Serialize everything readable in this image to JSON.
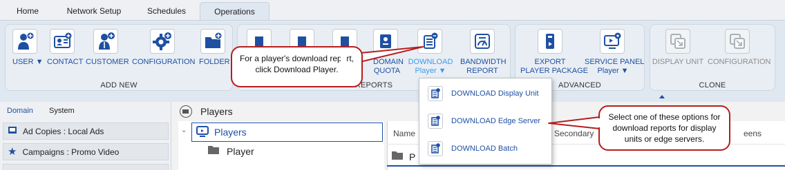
{
  "tabs": [
    {
      "label": "Home"
    },
    {
      "label": "Network Setup"
    },
    {
      "label": "Schedules"
    },
    {
      "label": "Operations",
      "active": true
    }
  ],
  "ribbon": {
    "add_new": {
      "group_label": "ADD NEW",
      "buttons": [
        {
          "label": "USER ▼",
          "icon": "user-add-icon"
        },
        {
          "label": "CONTACT",
          "icon": "contact-card-icon"
        },
        {
          "label": "CUSTOMER",
          "icon": "customer-add-icon"
        },
        {
          "label": "CONFIGURATION",
          "icon": "gear-add-icon"
        },
        {
          "label": "FOLDER",
          "icon": "folder-add-icon"
        }
      ]
    },
    "reports": {
      "group_label": "REPORTS",
      "domain_quota": {
        "line1": "DOMAIN",
        "line2": "QUOTA"
      },
      "download_player": {
        "line1": "DOWNLOAD",
        "line2": "Player ▼"
      },
      "bandwidth_report": {
        "line1": "BANDWIDTH",
        "line2": "REPORT"
      }
    },
    "advanced": {
      "group_label": "ADVANCED",
      "export_player_package": {
        "line1": "EXPORT",
        "line2": "PLAYER PACKAGE"
      },
      "service_panel": {
        "line1": "SERVICE PANEL",
        "line2": "Player ▼"
      }
    },
    "clone": {
      "group_label": "CLONE",
      "buttons": [
        {
          "label": "DISPLAY UNIT",
          "icon": "clone-display-icon"
        },
        {
          "label": "CONFIGURATION",
          "icon": "clone-config-icon"
        }
      ]
    }
  },
  "dropdown": {
    "items": [
      {
        "label": "DOWNLOAD Display Unit"
      },
      {
        "label": "DOWNLOAD Edge Server"
      },
      {
        "label": "DOWNLOAD Batch"
      }
    ]
  },
  "left_pane": {
    "tabs": [
      {
        "label": "Domain",
        "active": true
      },
      {
        "label": "System"
      }
    ],
    "items": [
      {
        "label": "Ad Copies : Local Ads"
      },
      {
        "label": "Campaigns : Promo Video"
      }
    ]
  },
  "main": {
    "crumb": "Players",
    "tree": [
      {
        "label": "Players"
      },
      {
        "label": "Player"
      }
    ],
    "grid": {
      "col_name": "Name",
      "col_secondary": "Secondary",
      "col_screens": "eens",
      "row_partial": "P"
    }
  },
  "callouts": {
    "top": "For a player's download report, click Download Player.",
    "right": "Select one of these options for download reports for display units or edge servers."
  },
  "colors": {
    "accent": "#1e50a2",
    "callout_border": "#b51d1d",
    "highlight": "#3d9ae8"
  }
}
